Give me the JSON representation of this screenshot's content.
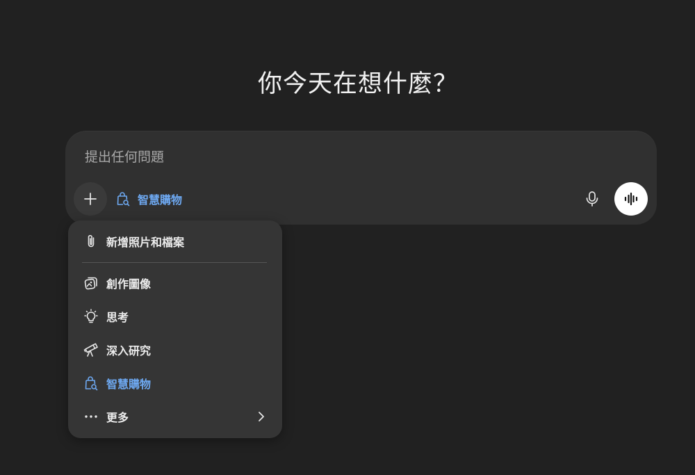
{
  "main": {
    "heading": "你今天在想什麼？"
  },
  "composer": {
    "placeholder": "提出任何問題",
    "active_tool_chip": "智慧購物"
  },
  "tools_menu": {
    "items": [
      {
        "label": "新增照片和檔案",
        "icon": "paperclip-icon"
      },
      {
        "label": "創作圖像",
        "icon": "image-create-icon"
      },
      {
        "label": "思考",
        "icon": "lightbulb-icon"
      },
      {
        "label": "深入研究",
        "icon": "telescope-icon"
      },
      {
        "label": "智慧購物",
        "icon": "shopping-bag-search-icon"
      },
      {
        "label": "更多",
        "icon": "more-dots-icon"
      }
    ]
  },
  "colors": {
    "background": "#212121",
    "composer": "#303030",
    "menu": "#353535",
    "accent": "#6ea9f2",
    "text": "#ececec"
  }
}
